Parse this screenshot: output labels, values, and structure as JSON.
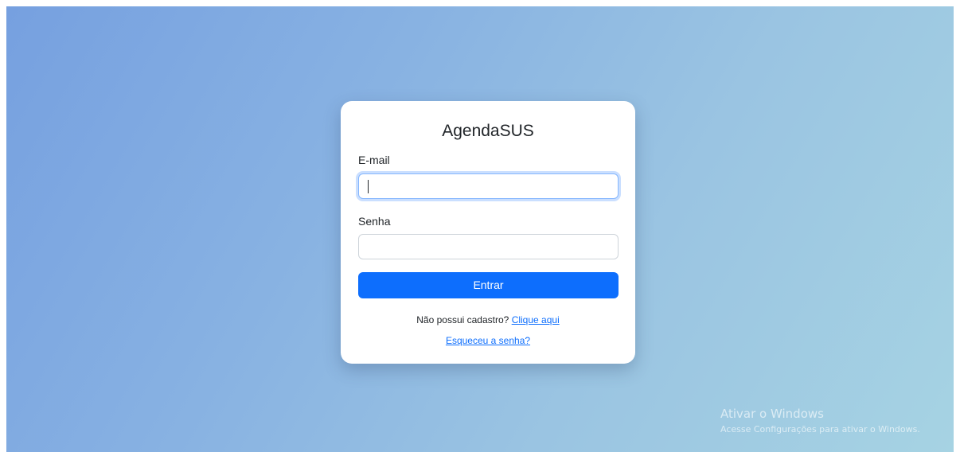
{
  "login": {
    "title": "AgendaSUS",
    "email_label": "E-mail",
    "email_value": "",
    "password_label": "Senha",
    "password_value": "",
    "submit_label": "Entrar",
    "signup_prompt": "Não possui cadastro?",
    "signup_link": "Clique aqui",
    "forgot_link": "Esqueceu a senha?"
  },
  "watermark": {
    "title": "Ativar o Windows",
    "subtitle": "Acesse Configurações para ativar o Windows."
  },
  "colors": {
    "primary": "#0d6efd",
    "background_start": "#76a0e0",
    "background_end": "#a6d3e3"
  }
}
